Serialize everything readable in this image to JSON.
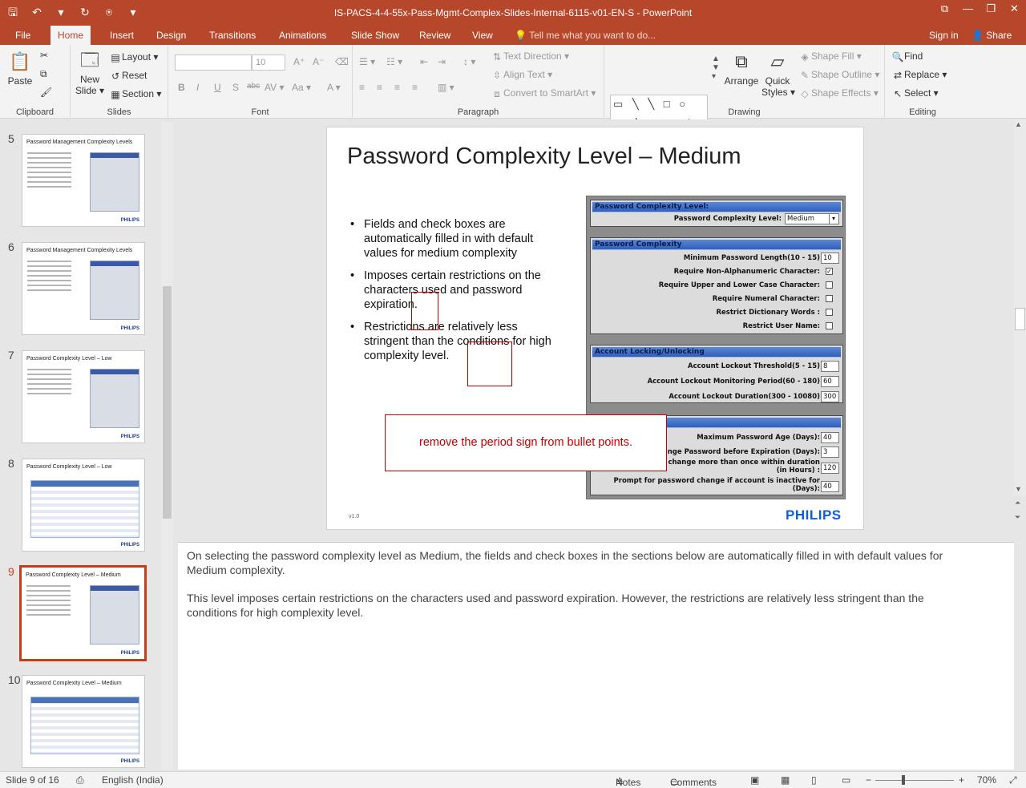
{
  "window": {
    "title": "IS-PACS-4-4-55x-Pass-Mgmt-Complex-Slides-Internal-6115-v01-EN-S - PowerPoint",
    "controls": [
      "⧉",
      "—",
      "❐",
      "✕"
    ]
  },
  "quick_access": {
    "save": "🖫",
    "undo": "↶",
    "undo_more": "▾",
    "repeat": "↻",
    "present": "⍟",
    "customize": "▾"
  },
  "tabs": [
    {
      "label": "File"
    },
    {
      "label": "Home"
    },
    {
      "label": "Insert"
    },
    {
      "label": "Design"
    },
    {
      "label": "Transitions"
    },
    {
      "label": "Animations"
    },
    {
      "label": "Slide Show"
    },
    {
      "label": "Review"
    },
    {
      "label": "View"
    }
  ],
  "tell_me": "Tell me what you want to do...",
  "sign_in": "Sign in",
  "share": "Share",
  "ribbon": {
    "clipboard": {
      "name": "Clipboard",
      "paste": "Paste"
    },
    "slides": {
      "name": "Slides",
      "new_slide": "New",
      "new_slide2": "Slide ▾",
      "layout": "Layout ▾",
      "reset": "Reset",
      "section": "Section ▾"
    },
    "font": {
      "name": "Font",
      "size": "10",
      "bold": "B",
      "italic": "I",
      "underline": "U",
      "shadow": "S",
      "strike": "abc",
      "spacing": "AV ▾",
      "case": "Aa ▾",
      "color": "A ▾"
    },
    "paragraph": {
      "name": "Paragraph",
      "text_direction": "Text Direction ▾",
      "align_text": "Align Text ▾",
      "smartart": "Convert to SmartArt ▾"
    },
    "drawing": {
      "name": "Drawing",
      "shapes": "▭ ╲ ╲ □ ○ ▭ △ ┐ ┐ ⇨ ⇩ ⬠ ⌒ ⌒ ∿ { } ☆",
      "arrange": "Arrange",
      "quick_styles": "Quick",
      "quick_styles2": "Styles ▾",
      "shape_fill": "Shape Fill ▾",
      "shape_outline": "Shape Outline ▾",
      "shape_effects": "Shape Effects ▾"
    },
    "editing": {
      "name": "Editing",
      "find": "Find",
      "replace": "Replace ▾",
      "select": "Select ▾"
    }
  },
  "thumbnails": [
    {
      "num": "5",
      "title": "Password Management Complexity Levels",
      "kind": "text-image"
    },
    {
      "num": "6",
      "title": "Password Management Complexity Levels",
      "kind": "text-image"
    },
    {
      "num": "7",
      "title": "Password Complexity Level – Low",
      "kind": "text-image"
    },
    {
      "num": "8",
      "title": "Password Complexity Level – Low",
      "kind": "table"
    },
    {
      "num": "9",
      "title": "Password Complexity Level – Medium",
      "kind": "text-image",
      "selected": true
    },
    {
      "num": "10",
      "title": "Password Complexity Level – Medium",
      "kind": "table"
    }
  ],
  "thumb_logo": "PHILIPS",
  "slide": {
    "title": "Password Complexity Level – Medium",
    "bullets": [
      "Fields and check boxes are automatically filled in with default values for medium complexity",
      "Imposes certain restrictions on the characters used and password expiration.",
      "Restrictions are relatively less stringent than the conditions for high complexity level."
    ],
    "version": "v1.0",
    "logo": "PHILIPS",
    "comment": "remove the period sign from bullet points."
  },
  "screenshot": {
    "level_header": "Password Complexity Level:",
    "level_label": "Password Complexity Level:",
    "level_value": "Medium",
    "complexity_header": "Password Complexity",
    "min_length_label": "Minimum Password Length(10 - 15)",
    "min_length_value": "10",
    "checks": [
      {
        "label": "Require Non-Alphanumeric Character:",
        "checked": "✓"
      },
      {
        "label": "Require Upper and Lower Case Character:",
        "checked": ""
      },
      {
        "label": "Require Numeral Character:",
        "checked": ""
      },
      {
        "label": "Restrict Dictionary Words :",
        "checked": ""
      },
      {
        "label": "Restrict User Name:",
        "checked": ""
      }
    ],
    "locking_header": "Account Locking/Unlocking",
    "locking": [
      {
        "label": "Account Lockout Threshold(5 - 15)",
        "value": "8"
      },
      {
        "label": "Account Lockout Monitoring Period(60 - 180)",
        "value": "60"
      },
      {
        "label": "Account Lockout Duration(300 - 10080)",
        "value": "300"
      }
    ],
    "expiry": [
      {
        "label": "Maximum Password Age (Days):",
        "value": "40"
      },
      {
        "label": "nge Password before Expiration (Days):",
        "value": "3"
      },
      {
        "label": "change more than once within duration",
        "label2": "(in Hours) :",
        "value": "120"
      },
      {
        "label": "Prompt for password change if account is inactive for",
        "label2": "(Days):",
        "value": "40"
      }
    ]
  },
  "notes": [
    "On selecting the password complexity level as Medium, the fields and check boxes in the sections below are automatically filled in with default values for Medium complexity.",
    "This level imposes certain restrictions on the characters used and password expiration. However, the restrictions are relatively less stringent than the conditions for high complexity level."
  ],
  "status": {
    "slide": "Slide 9 of 16",
    "language": "English (India)",
    "notes": "Notes",
    "comments": "Comments",
    "zoom": "70%"
  }
}
